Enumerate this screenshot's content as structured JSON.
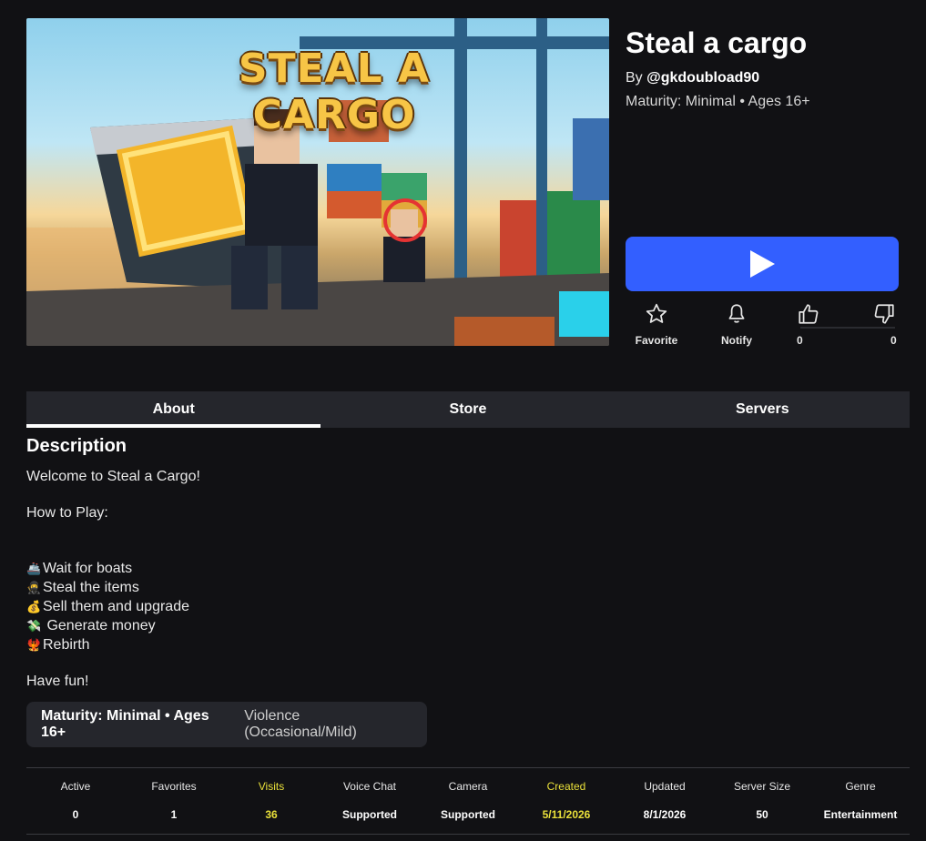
{
  "thumbnail": {
    "title_text": "STEAL A CARGO"
  },
  "game": {
    "title": "Steal a cargo",
    "by_prefix": "By",
    "creator": "@gkdoubload90",
    "maturity": "Maturity: Minimal • Ages 16+"
  },
  "actions": {
    "favorite_label": "Favorite",
    "notify_label": "Notify",
    "upvotes": "0",
    "downvotes": "0"
  },
  "tabs": [
    {
      "label": "About",
      "active": true
    },
    {
      "label": "Store",
      "active": false
    },
    {
      "label": "Servers",
      "active": false
    }
  ],
  "description": {
    "heading": "Description",
    "welcome": "Welcome to Steal a Cargo!",
    "how_to_play": "How to Play:",
    "steps": [
      {
        "icon": "🚢",
        "text": "Wait for boats"
      },
      {
        "icon": "🥷",
        "text": "Steal the items"
      },
      {
        "icon": "💰",
        "text": "Sell them and upgrade"
      },
      {
        "icon": "💸",
        "text": " Generate money"
      },
      {
        "icon": "🐦‍🔥",
        "text": "Rebirth"
      }
    ],
    "closing": "Have fun!"
  },
  "maturity_box": {
    "label": "Maturity: Minimal • Ages 16+",
    "descriptor": "Violence (Occasional/Mild)"
  },
  "stats": [
    {
      "key": "Active",
      "value": "0",
      "highlight": false
    },
    {
      "key": "Favorites",
      "value": "1",
      "highlight": false
    },
    {
      "key": "Visits",
      "value": "36",
      "highlight": true
    },
    {
      "key": "Voice Chat",
      "value": "Supported",
      "highlight": false
    },
    {
      "key": "Camera",
      "value": "Supported",
      "highlight": false
    },
    {
      "key": "Created",
      "value": "5/11/2026",
      "highlight": true
    },
    {
      "key": "Updated",
      "value": "8/1/2026",
      "highlight": false
    },
    {
      "key": "Server Size",
      "value": "50",
      "highlight": false
    },
    {
      "key": "Genre",
      "value": "Entertainment",
      "highlight": false
    }
  ],
  "colors": {
    "background": "#111114",
    "panel": "#25262c",
    "play_button": "#335fff",
    "highlight": "#e9e03a"
  },
  "icons": [
    "play-icon",
    "star-icon",
    "bell-icon",
    "thumbs-up-icon",
    "thumbs-down-icon"
  ]
}
